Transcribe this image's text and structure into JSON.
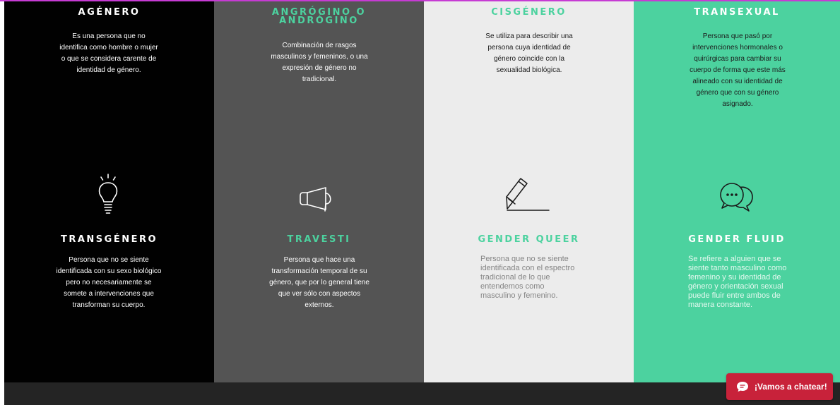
{
  "columns": [
    {
      "top_title": "AGÉNERO",
      "top_desc": "Es una persona que no identifica como hombre o mujer o que se considera carente de identidad de género.",
      "bottom_title": "TRANSGÉNERO",
      "bottom_desc": "Persona que no se siente identificada con su sexo biológico pero no necesariamente se somete a intervenciones que transforman su cuerpo.",
      "icon": "lightbulb-icon"
    },
    {
      "top_title": "ANGRÓGINO O ANDRÓGINO",
      "top_desc": "Combinación de rasgos masculinos y femeninos, o una expresión de género no tradicional.",
      "bottom_title": "TRAVESTI",
      "bottom_desc": "Persona que hace una transformación temporal de su género, que por lo general tiene que ver sólo con aspectos externos.",
      "icon": "megaphone-icon"
    },
    {
      "top_title": "CISGÉNERO",
      "top_desc": "Se utiliza para describir una persona cuya identidad de género coincide con la sexualidad biológica.",
      "bottom_title": "GENDER QUEER",
      "bottom_desc": "Persona que no se siente identificada con el espectro tradicional de lo que entendemos como masculino y femenino.",
      "icon": "pencil-icon"
    },
    {
      "top_title": "TRANSEXUAL",
      "top_desc": "Persona que pasó por intervenciones hormonales o quirúrgicas para cambiar su cuerpo de forma que este más alineado con su identidad de género que con su género asignado.",
      "bottom_title": "GENDER FLUID",
      "bottom_desc": "Se refiere a alguien que se siente tanto masculino como femenino y su identidad de género y orientación sexual puede fluir entre ambos de manera constante.",
      "icon": "chat-bubbles-icon"
    }
  ],
  "chat_button": {
    "label": "¡Vamos a chatear!",
    "icon": "chat-icon"
  },
  "colors": {
    "black_column": "#010101",
    "gray_column": "#545454",
    "light_column": "#ececec",
    "green_accent": "#4cd29f",
    "chat_button": "#c8223a",
    "footer": "#242424",
    "top_border": "#c63bd3"
  }
}
